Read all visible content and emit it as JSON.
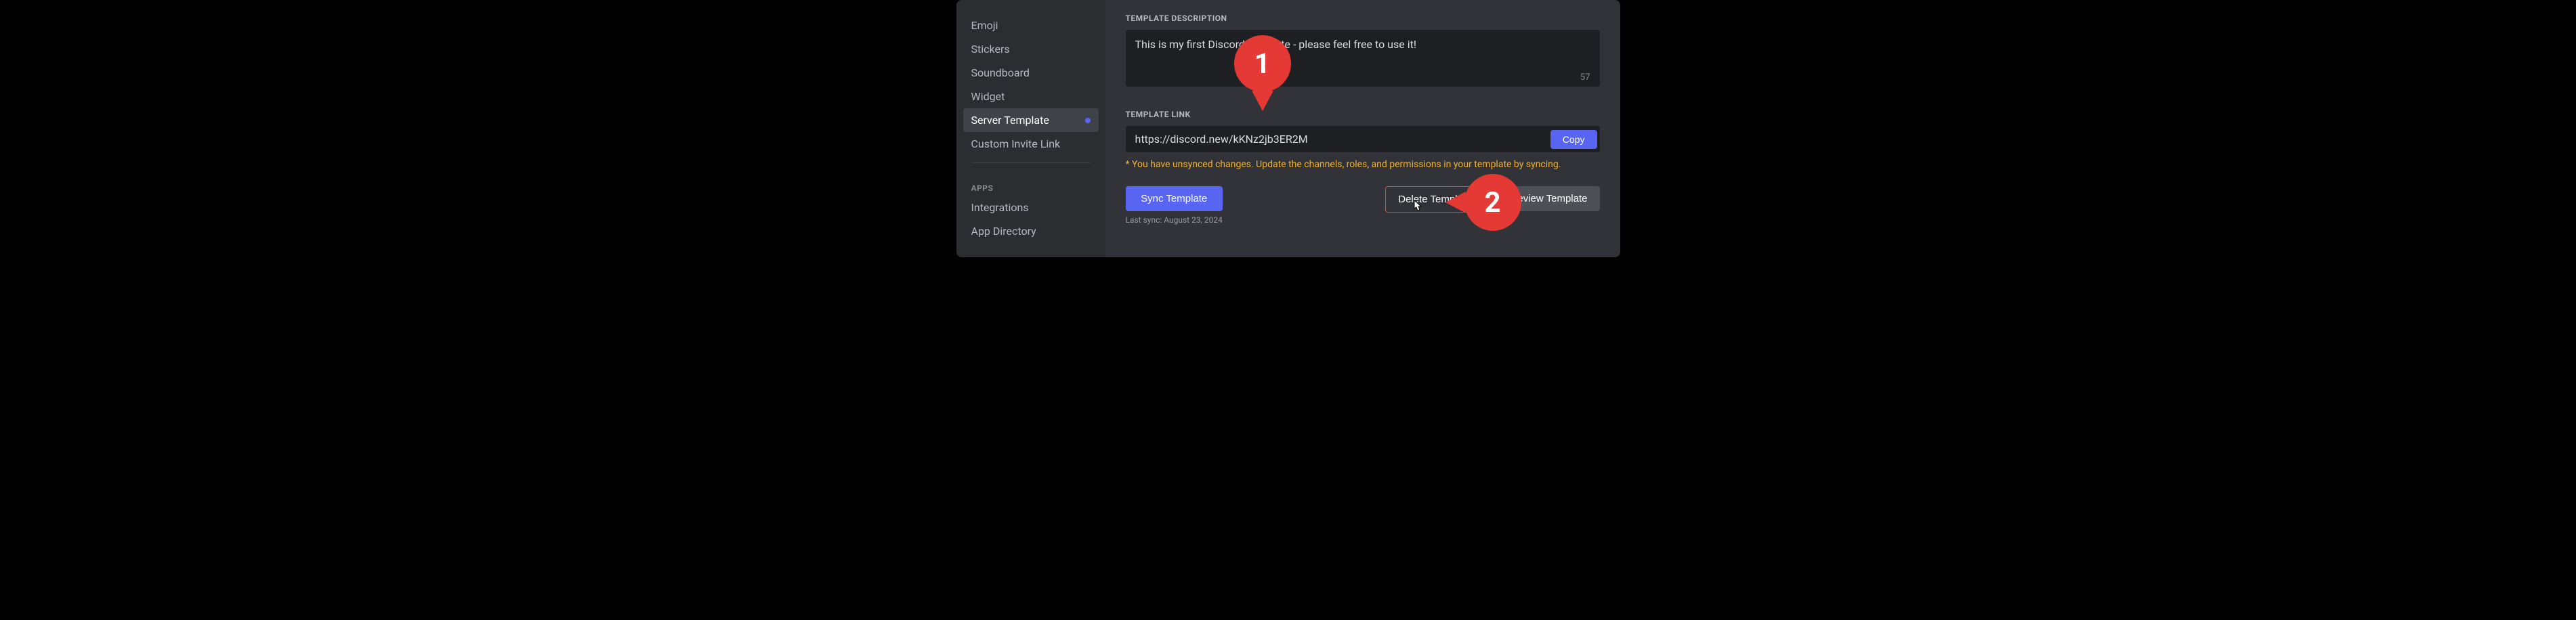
{
  "sidebar": {
    "items": [
      {
        "label": "Emoji"
      },
      {
        "label": "Stickers"
      },
      {
        "label": "Soundboard"
      },
      {
        "label": "Widget"
      },
      {
        "label": "Server Template",
        "active": true,
        "indicator": true
      },
      {
        "label": "Custom Invite Link"
      }
    ],
    "apps_heading": "APPS",
    "apps_items": [
      {
        "label": "Integrations"
      },
      {
        "label": "App Directory"
      }
    ]
  },
  "main": {
    "description_label": "TEMPLATE DESCRIPTION",
    "description_value": "This is my first Discord template - please feel free to use it!",
    "char_count": "57",
    "link_label": "TEMPLATE LINK",
    "link_value": "https://discord.new/kKNz2jb3ER2M",
    "copy_label": "Copy",
    "warning_text": "* You have unsynced changes. Update the channels, roles, and permissions in your template by syncing.",
    "sync_label": "Sync Template",
    "last_sync": "Last sync: August 23, 2024",
    "delete_label": "Delete Template",
    "preview_label": "Preview Template"
  },
  "annotations": {
    "marker1": "1",
    "marker2": "2"
  }
}
